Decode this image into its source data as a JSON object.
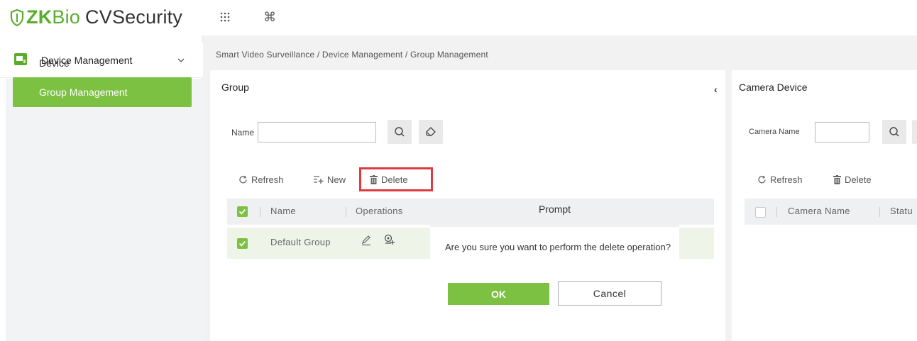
{
  "app": {
    "logo_zk": "ZK",
    "logo_bio": "Bio",
    "logo_rest": "CVSecurity",
    "grid_icon": "grid-menu-icon",
    "cmd_icon": "command-icon"
  },
  "sidebar": {
    "section_label": "Device Management",
    "items": [
      {
        "label": "Device"
      },
      {
        "label": "Group Management",
        "active": true
      }
    ]
  },
  "breadcrumb": "Smart Video Surveillance / Device Management / Group Management",
  "group_panel": {
    "title": "Group",
    "name_label": "Name",
    "name_value": "",
    "toolbar": {
      "refresh": "Refresh",
      "new": "New",
      "delete": "Delete"
    },
    "columns": [
      "Name",
      "Operations"
    ],
    "rows": [
      {
        "name": "Default Group",
        "checked": true
      }
    ]
  },
  "camera_panel": {
    "title": "Camera Device",
    "name_label": "Camera Name",
    "name_value": "",
    "toolbar": {
      "refresh": "Refresh",
      "delete": "Delete"
    },
    "columns": [
      "Camera Name",
      "Statu"
    ]
  },
  "dialog": {
    "title": "Prompt",
    "message": "Are you sure you want to perform the delete operation?",
    "ok": "OK",
    "cancel": "Cancel"
  },
  "colors": {
    "accent": "#7cc142",
    "highlight": "#e0393e"
  }
}
